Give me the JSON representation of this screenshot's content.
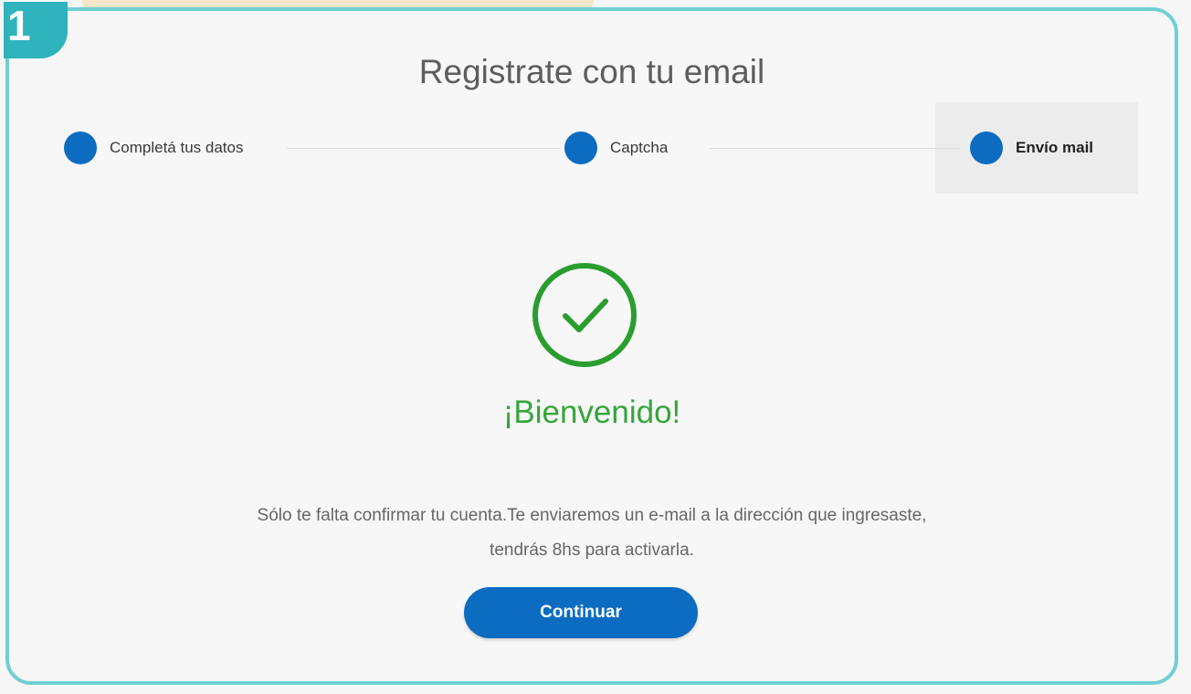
{
  "badge": {
    "number": "1"
  },
  "page": {
    "title": "Registrate con tu email"
  },
  "stepper": {
    "steps": [
      {
        "label": "Completá tus datos",
        "state": "done"
      },
      {
        "label": "Captcha",
        "state": "done"
      },
      {
        "label": "Envío mail",
        "state": "active"
      }
    ]
  },
  "status": {
    "icon": "check-circle-icon",
    "heading": "¡Bienvenido!",
    "message_line1": "Sólo te falta confirmar tu cuenta.Te enviaremos un e-mail a la dirección que ingresaste,",
    "message_line2": "tendrás 8hs para activarla."
  },
  "actions": {
    "continue_label": "Continuar"
  },
  "colors": {
    "accent_blue": "#0b6cc1",
    "success_green": "#35a53a",
    "frame_teal": "#6fcfd4"
  }
}
